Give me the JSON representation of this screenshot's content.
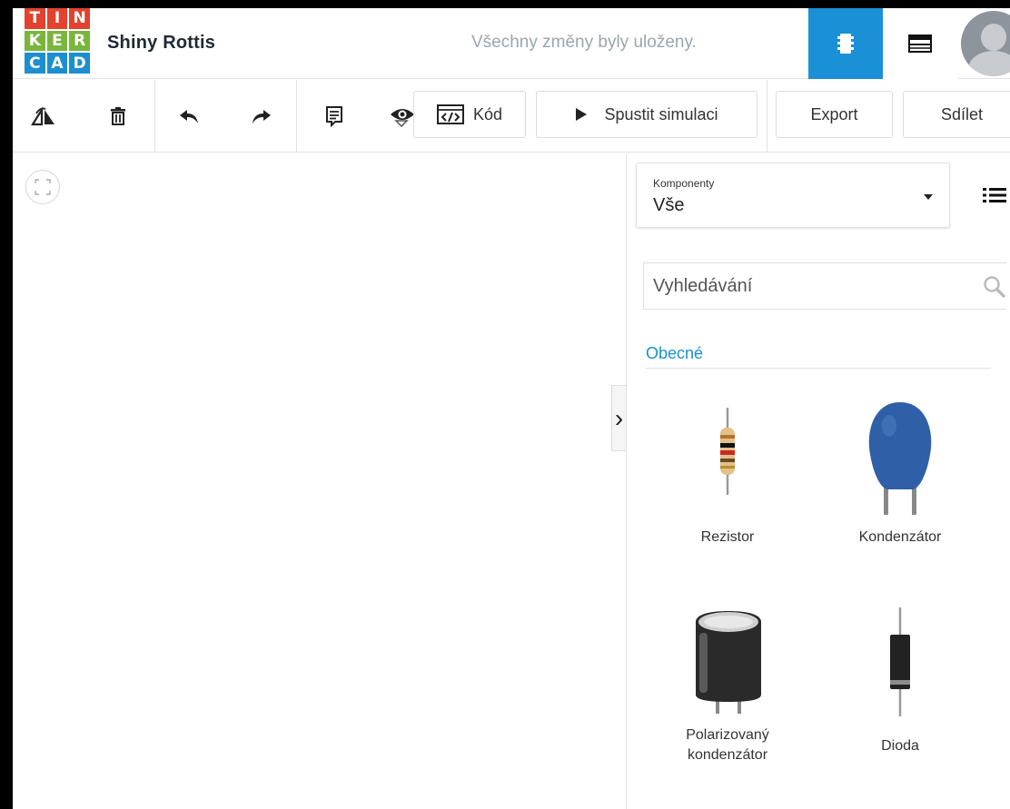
{
  "header": {
    "logo_letters": [
      "T",
      "I",
      "N",
      "K",
      "E",
      "R",
      "C",
      "A",
      "D"
    ],
    "project_name": "Shiny Rottis",
    "save_status": "Všechny změny byly uloženy.",
    "accent_color": "#1a90d6"
  },
  "toolbar": {
    "code_label": "Kód",
    "simulate_label": "Spustit simulaci",
    "export_label": "Export",
    "share_label": "Sdílet"
  },
  "panel": {
    "components_label": "Komponenty",
    "components_value": "Vše",
    "search_placeholder": "Vyhledávání",
    "section_title": "Obecné",
    "components": [
      {
        "label": "Rezistor",
        "icon": "resistor-icon"
      },
      {
        "label": "Kondenzátor",
        "icon": "ceramic-capacitor-icon"
      },
      {
        "label": "Polarizovaný kondenzátor",
        "icon": "electrolytic-capacitor-icon"
      },
      {
        "label": "Dioda",
        "icon": "diode-icon"
      }
    ]
  }
}
